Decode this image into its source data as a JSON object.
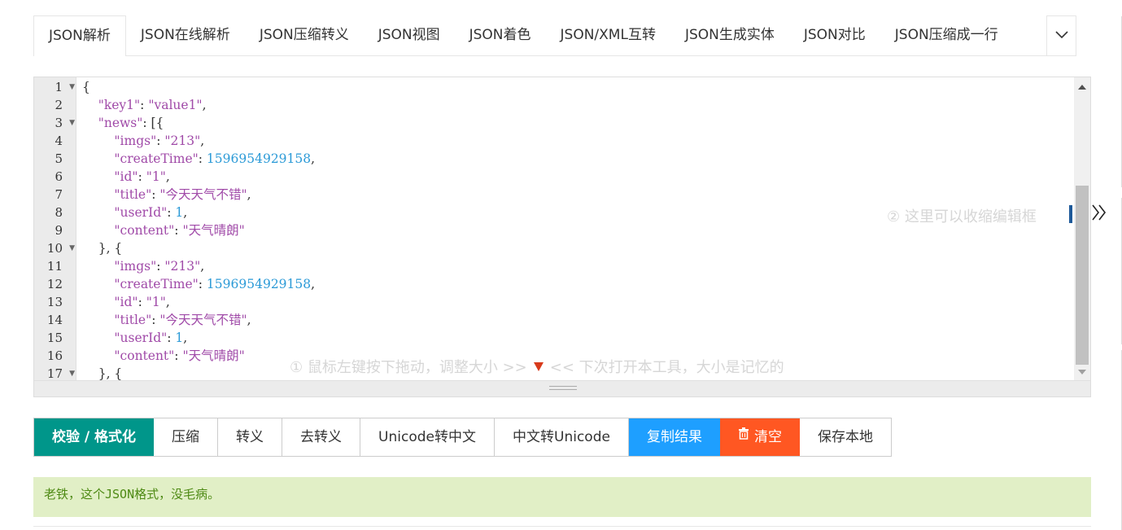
{
  "tabs": [
    {
      "label": "JSON解析",
      "active": true
    },
    {
      "label": "JSON在线解析"
    },
    {
      "label": "JSON压缩转义"
    },
    {
      "label": "JSON视图"
    },
    {
      "label": "JSON着色"
    },
    {
      "label": "JSON/XML互转"
    },
    {
      "label": "JSON生成实体"
    },
    {
      "label": "JSON对比"
    },
    {
      "label": "JSON压缩成一行"
    }
  ],
  "tab_more_icon": "chevron-down-icon",
  "editor": {
    "line_numbers": [
      "1",
      "2",
      "3",
      "4",
      "5",
      "6",
      "7",
      "8",
      "9",
      "10",
      "11",
      "12",
      "13",
      "14",
      "15",
      "16",
      "17"
    ],
    "fold_lines": [
      "1",
      "3",
      "10",
      "17"
    ],
    "lines": [
      "{",
      "    \"key1\": \"value1\",",
      "    \"news\": [{",
      "        \"imgs\": \"213\",",
      "        \"createTime\": 1596954929158,",
      "        \"id\": \"1\",",
      "        \"title\": \"今天天气不错\",",
      "        \"userId\": 1,",
      "        \"content\": \"天气晴朗\"",
      "    }, {",
      "        \"imgs\": \"213\",",
      "        \"createTime\": 1596954929158,",
      "        \"id\": \"1\",",
      "        \"title\": \"今天天气不错\",",
      "        \"userId\": 1,",
      "        \"content\": \"天气晴朗\"",
      "    }, {"
    ]
  },
  "hints": {
    "collapse": "② 这里可以收缩编辑框",
    "resize_left": "① 鼠标左键按下拖动，调整大小 >>",
    "resize_right": "<< 下次打开本工具，大小是记忆的"
  },
  "buttons": {
    "format": "校验 / 格式化",
    "compress": "压缩",
    "escape": "转义",
    "unescape": "去转义",
    "unicode_to_cn": "Unicode转中文",
    "cn_to_unicode": "中文转Unicode",
    "copy": "复制结果",
    "clear": "清空",
    "save": "保存本地"
  },
  "colors": {
    "primary": "#00968a",
    "blue": "#1e9fff",
    "orange": "#ff5722",
    "json_key": "#a04aa8",
    "json_number": "#2b9ad7",
    "result_bg": "#e1efc6",
    "result_text": "#4e8a14"
  },
  "result_message": "老铁，这个JSON格式，没毛病。"
}
